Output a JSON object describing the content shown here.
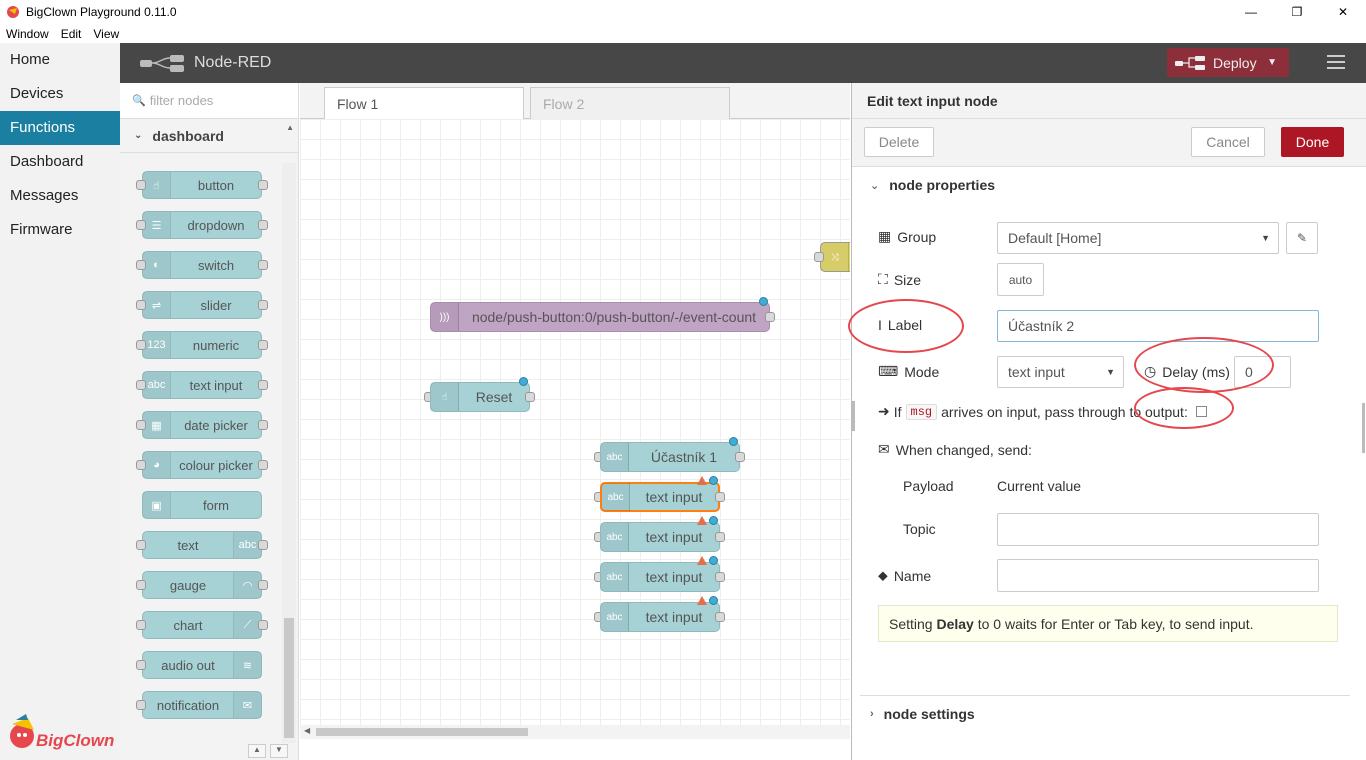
{
  "window": {
    "title": "BigClown Playground 0.11.0",
    "minimize": "—",
    "restore": "❐",
    "close": "✕"
  },
  "menu": [
    "Window",
    "Edit",
    "View"
  ],
  "leftnav": {
    "items": [
      "Home",
      "Devices",
      "Functions",
      "Dashboard",
      "Messages",
      "Firmware"
    ],
    "active": "Functions",
    "logo_text": "BigClown"
  },
  "nodered": {
    "title": "Node-RED",
    "deploy_label": "Deploy"
  },
  "palette": {
    "filter_placeholder": "filter nodes",
    "category": "dashboard",
    "nodes": [
      {
        "label": "button",
        "icon": "hand-icon"
      },
      {
        "label": "dropdown",
        "icon": "list-icon"
      },
      {
        "label": "switch",
        "icon": "toggle-icon"
      },
      {
        "label": "slider",
        "icon": "sliders-icon"
      },
      {
        "label": "numeric",
        "icon": "123"
      },
      {
        "label": "text input",
        "icon": "abc"
      },
      {
        "label": "date picker",
        "icon": "calendar-icon"
      },
      {
        "label": "colour picker",
        "icon": "palette-icon"
      },
      {
        "label": "form",
        "icon": "form-icon"
      },
      {
        "label": "text",
        "icon": "abc"
      },
      {
        "label": "gauge",
        "icon": "gauge-icon"
      },
      {
        "label": "chart",
        "icon": "chart-icon"
      },
      {
        "label": "audio out",
        "icon": "audio-icon"
      },
      {
        "label": "notification",
        "icon": "mail-icon"
      }
    ]
  },
  "workspace": {
    "tabs": [
      "Flow 1",
      "Flow 2"
    ],
    "nodes": {
      "mqtt": "node/push-button:0/push-button/-/event-count",
      "reset": "Reset",
      "ucastnik1": "Účastník 1",
      "text_inputs": [
        "text input",
        "text input",
        "text input",
        "text input"
      ]
    }
  },
  "editor": {
    "title": "Edit text input node",
    "delete_label": "Delete",
    "cancel_label": "Cancel",
    "done_label": "Done",
    "section_properties": "node properties",
    "section_settings": "node settings",
    "group_label": "Group",
    "group_value": "Default [Home]",
    "size_label": "Size",
    "size_value": "auto",
    "label_label": "Label",
    "label_value": "Účastník 2",
    "mode_label": "Mode",
    "mode_value": "text input",
    "delay_label": "Delay (ms)",
    "delay_value": "0",
    "passthrough_if": "If",
    "passthrough_code": "msg",
    "passthrough_text": "arrives on input, pass through to output:",
    "when_changed": "When changed, send:",
    "payload_label": "Payload",
    "payload_value": "Current value",
    "topic_label": "Topic",
    "topic_value": "",
    "name_label": "Name",
    "name_value": "",
    "tip_prefix": "Setting",
    "tip_bold": "Delay",
    "tip_suffix": "to 0 waits for Enter or Tab key, to send input."
  },
  "colors": {
    "accent_nav": "#1a7fa0",
    "deploy": "#8c2f3a",
    "done": "#ad1625",
    "dashboard_node": "#a6d2d6",
    "annotation": "#e5474c"
  }
}
